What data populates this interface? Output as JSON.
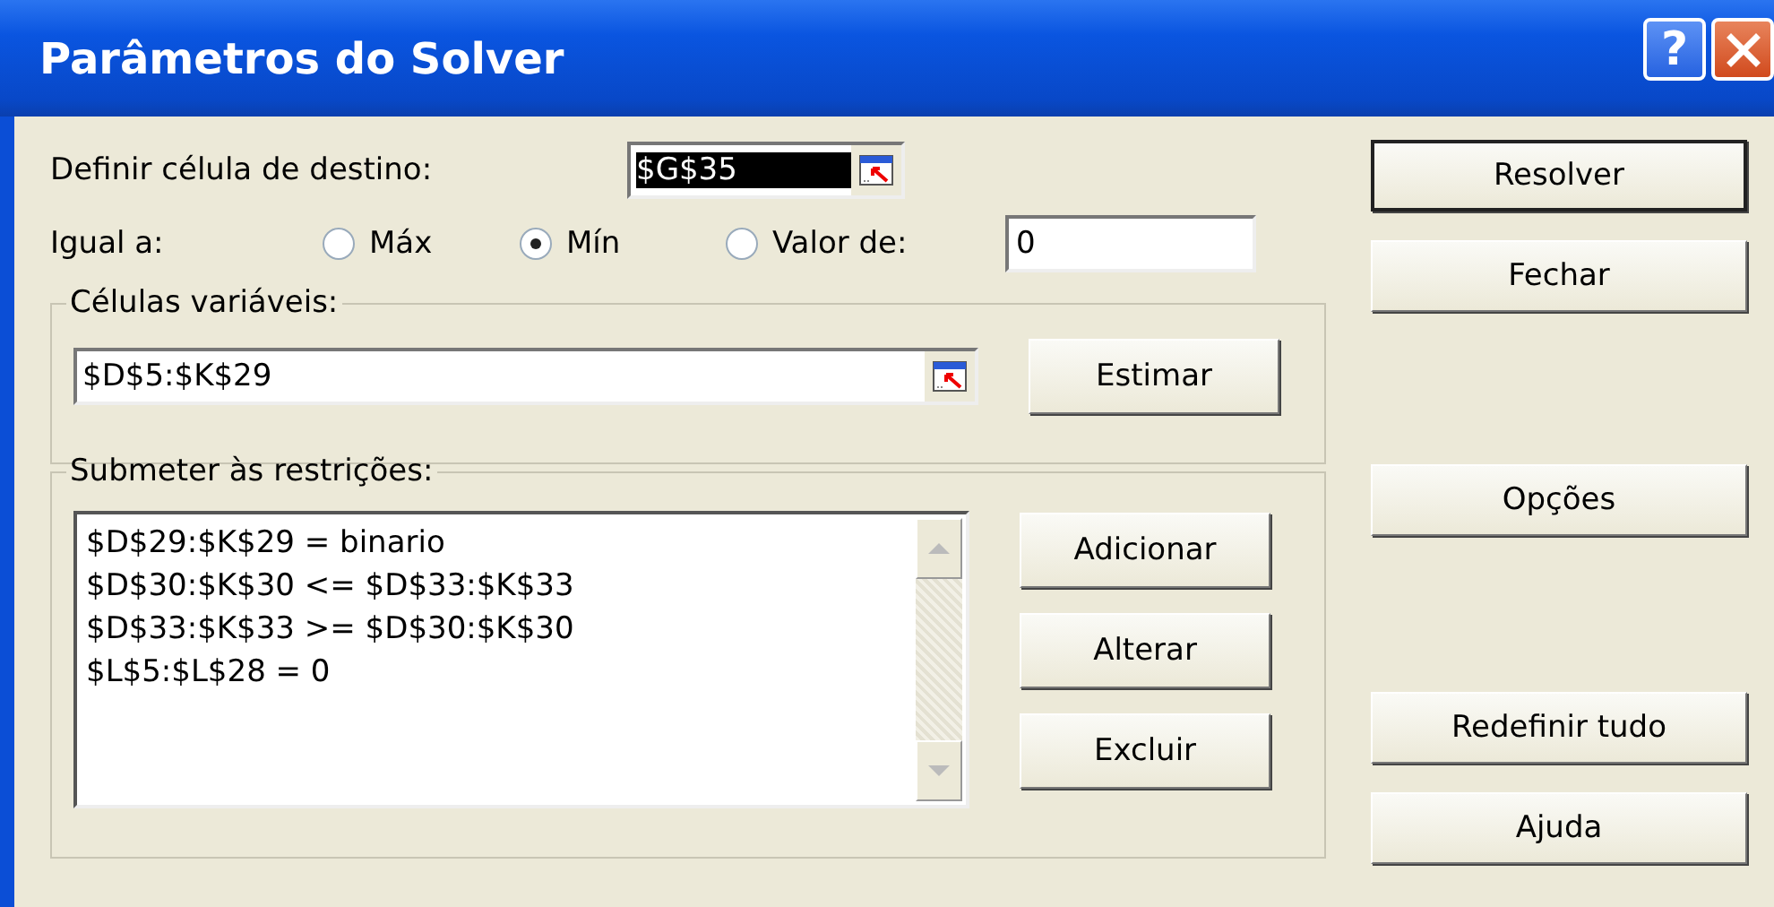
{
  "window": {
    "title": "Parâmetros do Solver",
    "help_button": "?"
  },
  "target_cell": {
    "label": "Definir célula de destino:",
    "value": "$G$35",
    "selected": true
  },
  "equal_to": {
    "label": "Igual a:",
    "options": [
      {
        "label": "Máx",
        "selected": false
      },
      {
        "label": "Mín",
        "selected": true
      },
      {
        "label": "Valor de:",
        "selected": false
      }
    ],
    "value": "0"
  },
  "variable_cells": {
    "legend": "Células variáveis:",
    "value": "$D$5:$K$29",
    "button": "Estimar"
  },
  "constraints": {
    "legend": "Submeter às restrições:",
    "items": [
      "$D$29:$K$29 = binario",
      "$D$30:$K$30 <= $D$33:$K$33",
      "$D$33:$K$33 >= $D$30:$K$30",
      "$L$5:$L$28 = 0"
    ],
    "buttons": [
      "Adicionar",
      "Alterar",
      "Excluir"
    ]
  },
  "buttons": [
    {
      "label": "Resolver",
      "default": true
    },
    {
      "label": "Fechar",
      "default": false
    },
    {
      "label": "Opções",
      "default": false
    },
    {
      "label": "Redefinir tudo",
      "default": false
    },
    {
      "label": "Ajuda",
      "default": false
    }
  ]
}
